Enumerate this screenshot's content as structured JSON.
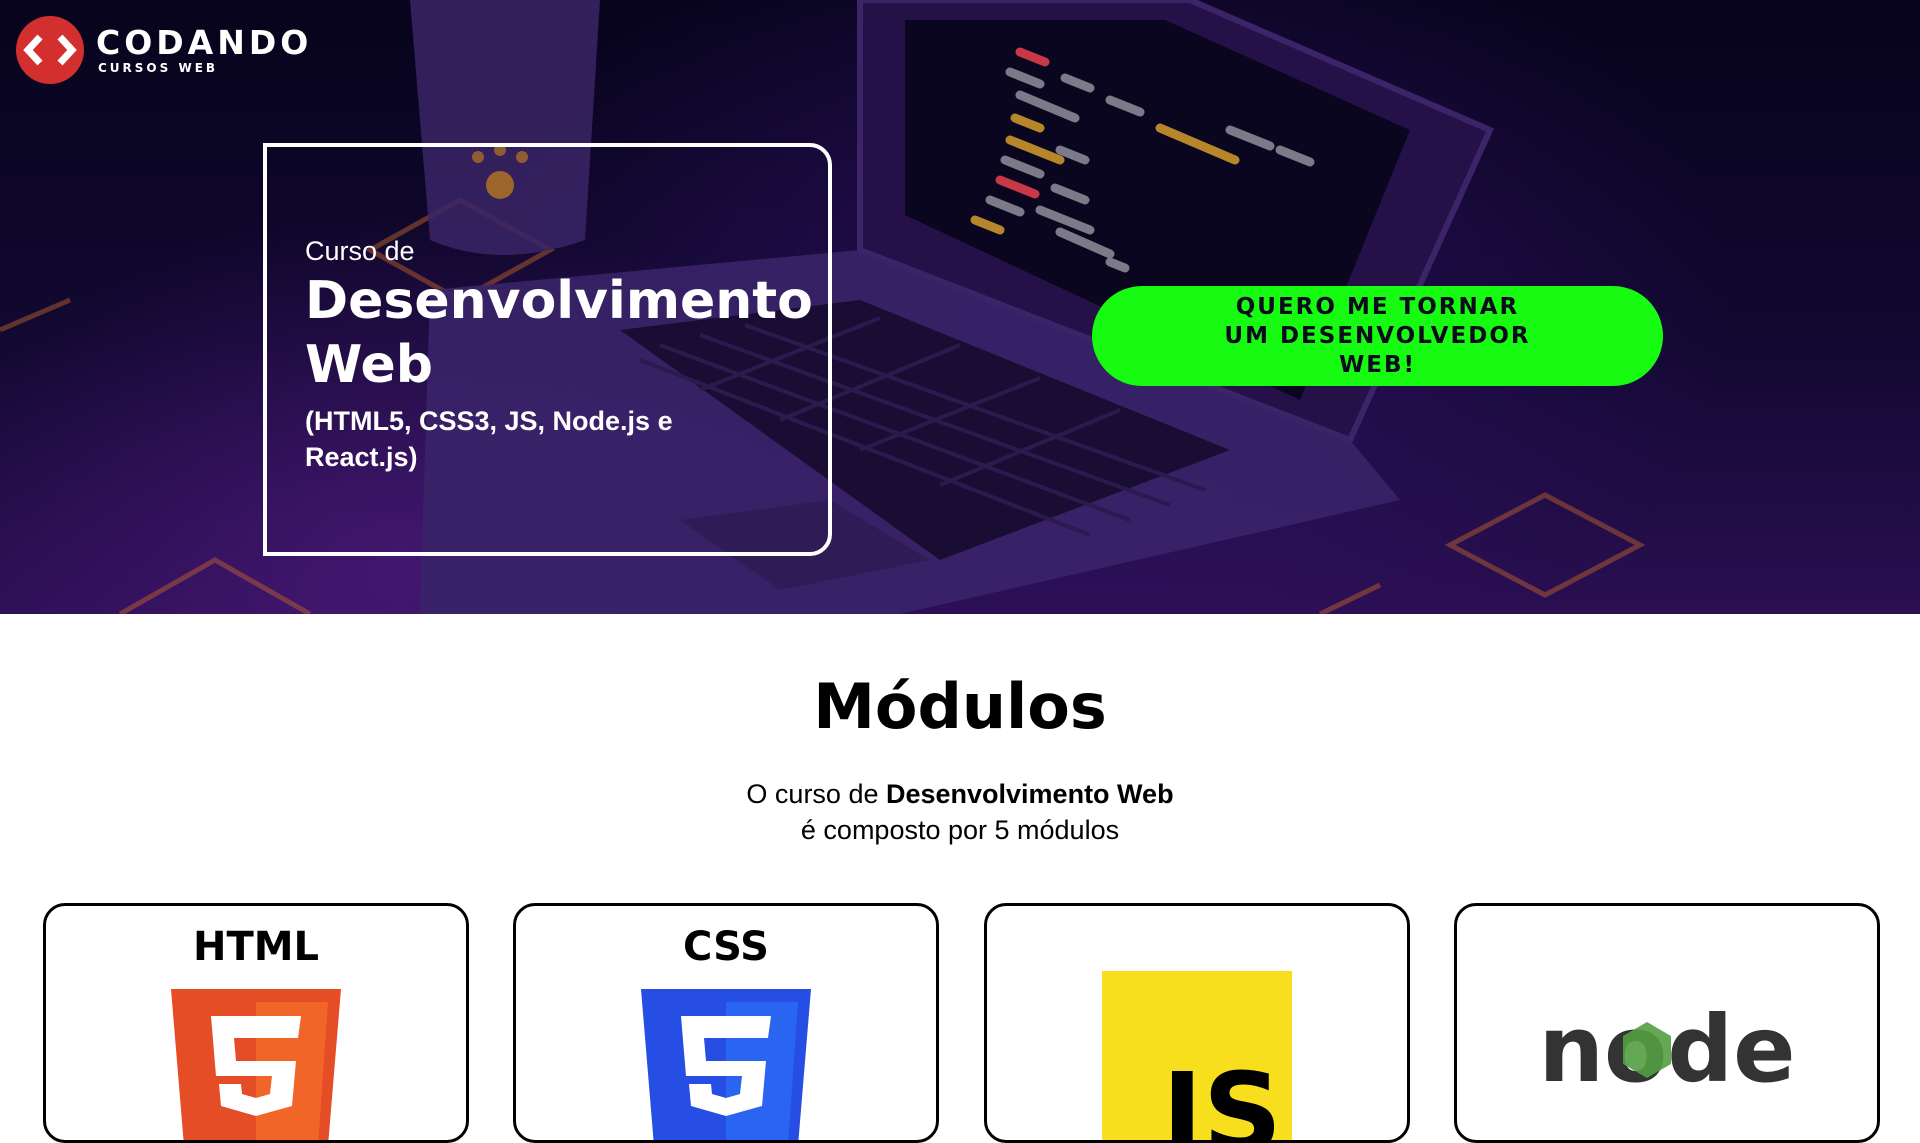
{
  "brand": {
    "name": "CODANDO",
    "tagline": "CURSOS WEB",
    "colors": {
      "logo_red": "#d32f2f",
      "cta_green": "#17fa11",
      "hero_dark": "#0b0720"
    }
  },
  "hero": {
    "course_pre": "Curso de",
    "course_title_line1": "Desenvolvimento",
    "course_title_line2": "Web",
    "course_stack_line1": "(HTML5, CSS3, JS, Node.js e",
    "course_stack_line2": "React.js)",
    "cta_label": "QUERO ME TORNAR UM DESENVOLVEDOR WEB!"
  },
  "modules": {
    "title": "Módulos",
    "intro_prefix": "O curso de ",
    "intro_bold": "Desenvolvimento Web",
    "intro_line2": "é composto por 5 módulos",
    "cards": [
      {
        "label": "HTML",
        "icon": "html5-logo-icon",
        "color": "#e44d26"
      },
      {
        "label": "CSS",
        "icon": "css3-logo-icon",
        "color": "#264de4"
      },
      {
        "label": "JS",
        "icon": "javascript-logo-icon",
        "color": "#f7df1e"
      },
      {
        "label": "node",
        "icon": "nodejs-logo-icon",
        "color": "#539e43"
      }
    ]
  }
}
